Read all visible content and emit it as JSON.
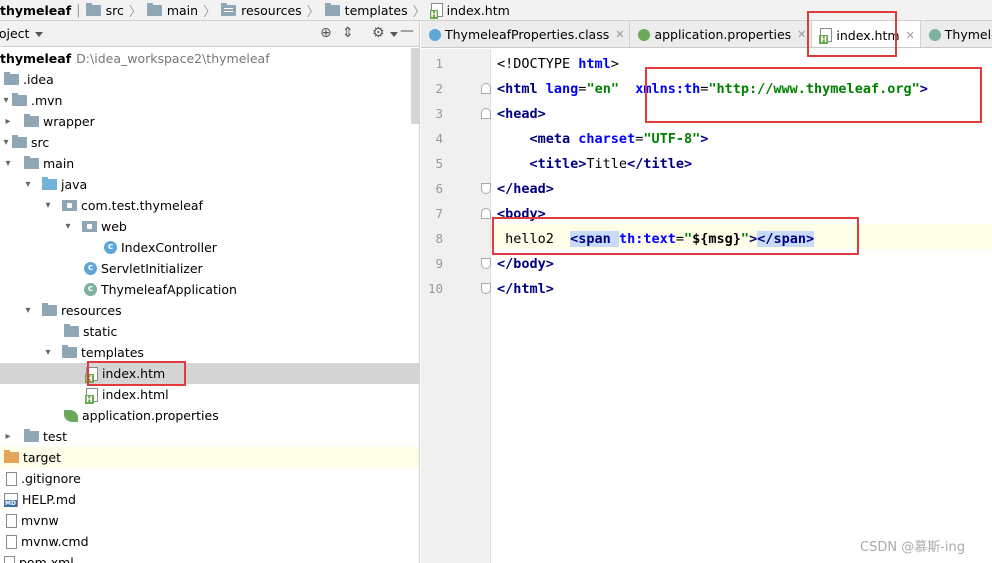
{
  "breadcrumb": [
    "thymeleaf",
    "src",
    "main",
    "resources",
    "templates",
    "index.htm"
  ],
  "project_panel": {
    "title": "roject",
    "root_name": "thymeleaf",
    "root_path": "D:\\idea_workspace2\\thymeleaf",
    "items": [
      {
        "label": ".idea"
      },
      {
        "label": ".mvn"
      },
      {
        "label": "wrapper"
      },
      {
        "label": "src"
      },
      {
        "label": "main"
      },
      {
        "label": "java"
      },
      {
        "label": "com.test.thymeleaf"
      },
      {
        "label": "web"
      },
      {
        "label": "IndexController"
      },
      {
        "label": "ServletInitializer"
      },
      {
        "label": "ThymeleafApplication"
      },
      {
        "label": "resources"
      },
      {
        "label": "static"
      },
      {
        "label": "templates"
      },
      {
        "label": "index.htm"
      },
      {
        "label": "index.html"
      },
      {
        "label": "application.properties"
      },
      {
        "label": "test"
      },
      {
        "label": "target"
      },
      {
        "label": ".gitignore"
      },
      {
        "label": "HELP.md"
      },
      {
        "label": "mvnw"
      },
      {
        "label": "mvnw.cmd"
      },
      {
        "label": "pom.xml"
      }
    ]
  },
  "tabs": [
    "ThymeleafProperties.class",
    "application.properties",
    "index.htm",
    "ThymeleafA"
  ],
  "active_tab": "index.htm",
  "line_numbers": [
    "1",
    "2",
    "3",
    "4",
    "5",
    "6",
    "7",
    "8",
    "9",
    "10"
  ],
  "code": {
    "l1_a": "<!DOCTYPE ",
    "l1_b": "html",
    "l1_c": ">",
    "l2_tag": "<html ",
    "l2_attr1": "lang",
    "l2_eq": "=",
    "l2_val1": "\"en\"",
    "l2_attr2": "xmlns:th",
    "l2_val2": "\"http://www.thymeleaf.org\"",
    "l2_end": ">",
    "l3": "<head>",
    "l4_tag": "<meta ",
    "l4_attr": "charset",
    "l4_val": "\"UTF-8\"",
    "l4_end": ">",
    "l5_open": "<title>",
    "l5_text": "Title",
    "l5_close": "</title>",
    "l6": "</head>",
    "l7": "<body>",
    "l8_text": "hello2  ",
    "l8_open": "<span ",
    "l8_attr": "th:text",
    "l8_q1": "\"",
    "l8_expr": "${msg}",
    "l8_q2": "\"",
    "l8_gt": ">",
    "l8_close": "</span>",
    "l9": "</body>",
    "l10": "</html>"
  },
  "watermark": "CSDN @慕斯-ing",
  "colors": {
    "annotation_red": "#e23b3b",
    "tag_blue": "#000080",
    "string_green": "#008000"
  }
}
